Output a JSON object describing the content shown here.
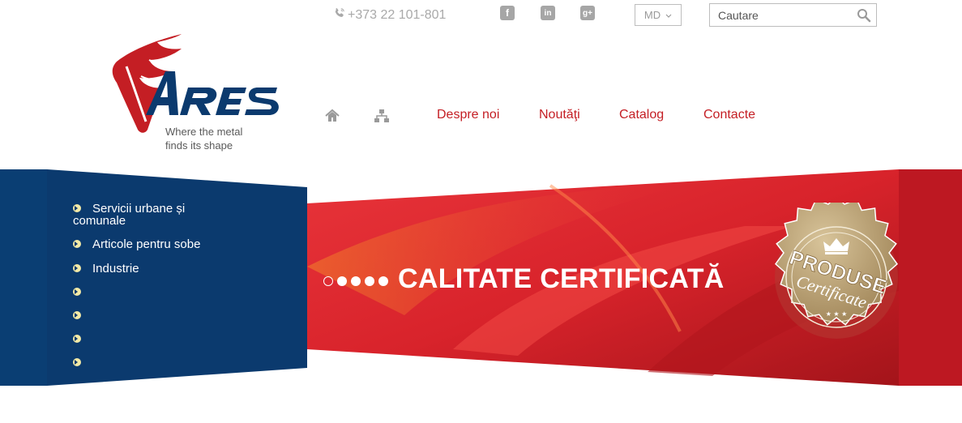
{
  "topbar": {
    "phone": "+373 22 101-801",
    "phone_icon": "phone-icon",
    "social": [
      {
        "name": "facebook-icon",
        "glyph": "f"
      },
      {
        "name": "linkedin-icon",
        "glyph": "in"
      },
      {
        "name": "google-plus-icon",
        "glyph": "g+"
      }
    ],
    "language": "MD",
    "search_placeholder": "Cautare"
  },
  "logo": {
    "brand": "ARES",
    "tagline_line1": "Where the metal",
    "tagline_line2": "finds its shape"
  },
  "nav": {
    "icons": [
      "home-icon",
      "sitemap-icon"
    ],
    "links": [
      "Despre noi",
      "Noutăţi",
      "Catalog",
      "Contacte"
    ]
  },
  "sidebar": {
    "items": [
      {
        "label": "Servicii urbane și comunale"
      },
      {
        "label": "Articole pentru sobe"
      },
      {
        "label": "Industrie"
      },
      {
        "label": ""
      },
      {
        "label": ""
      },
      {
        "label": ""
      },
      {
        "label": ""
      }
    ]
  },
  "slider": {
    "title": "CALITATE CERTIFICATĂ",
    "dot_count": 5,
    "active_dot": 0,
    "seal_text_1": "PRODUSE",
    "seal_text_2": "Certificate"
  },
  "colors": {
    "accent_red": "#c41e24",
    "navy": "#0b3a6e",
    "gray": "#a6a6a6"
  }
}
